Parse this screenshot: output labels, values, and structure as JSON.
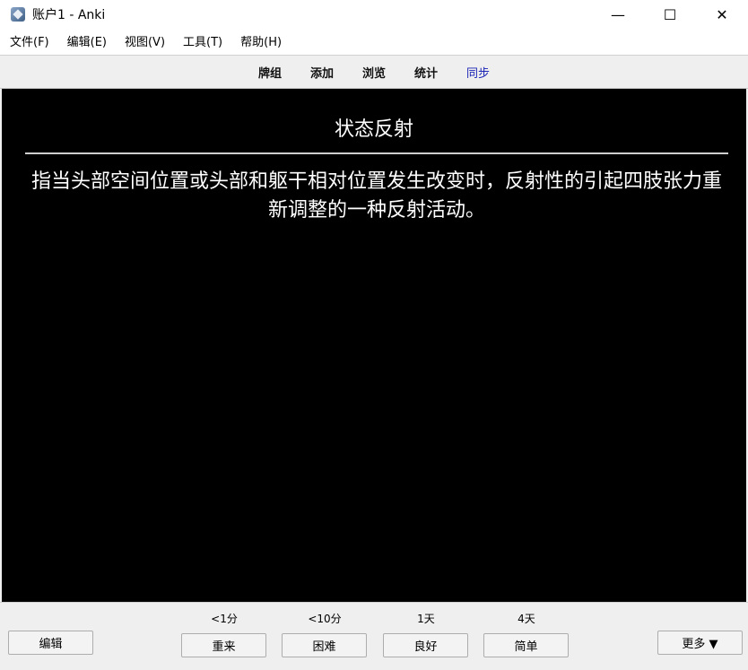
{
  "window": {
    "title": "账户1 - Anki",
    "minimize_glyph": "—",
    "maximize_glyph": "☐",
    "close_glyph": "✕"
  },
  "menu": {
    "items": [
      "文件(F)",
      "编辑(E)",
      "视图(V)",
      "工具(T)",
      "帮助(H)"
    ]
  },
  "toolbar": {
    "links": [
      "牌组",
      "添加",
      "浏览",
      "统计",
      "同步"
    ]
  },
  "card": {
    "front": "状态反射",
    "back": "指当头部空间位置或头部和躯干相对位置发生改变时，反射性的引起四肢张力重新调整的一种反射活动。"
  },
  "bottom": {
    "edit_label": "编辑",
    "more_label": "更多 ▼",
    "answers": [
      {
        "label": "重来",
        "interval": "<1分"
      },
      {
        "label": "困难",
        "interval": "<10分"
      },
      {
        "label": "良好",
        "interval": "1天"
      },
      {
        "label": "简单",
        "interval": "4天"
      }
    ]
  },
  "colors": {
    "card_background": "#000000",
    "card_text": "#ffffff",
    "sync_link": "#1a24b5",
    "bar_background": "#efefef"
  }
}
